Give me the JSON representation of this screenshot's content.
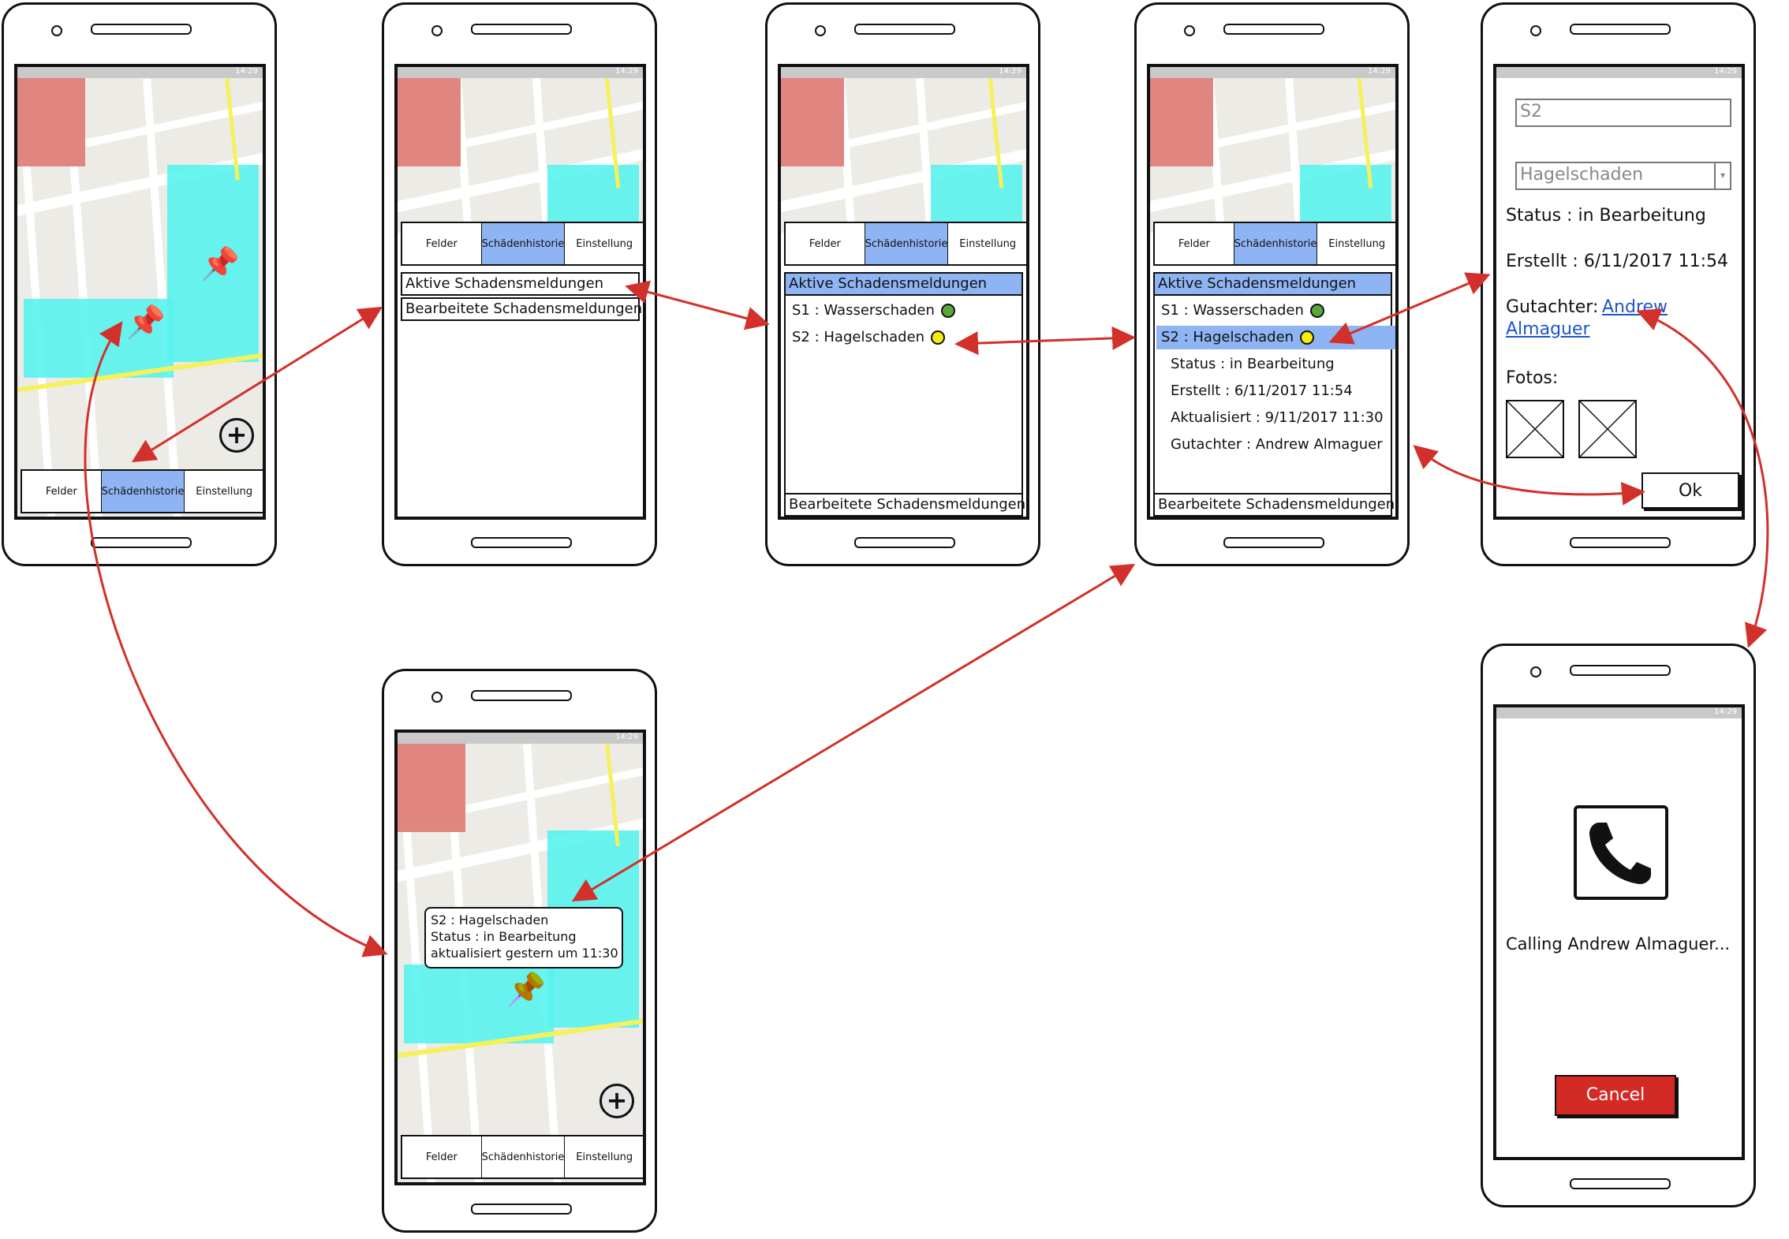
{
  "status_time": "14:29",
  "tabs": [
    "Felder",
    "Schädenhistorie",
    "Einstellung"
  ],
  "fab_symbol": "+",
  "lists": {
    "active": "Aktive Schadensmeldungen",
    "processed": "Bearbeitete Schadensmeldungen"
  },
  "reports": [
    {
      "label": "S1 : Wasserschaden",
      "status_color": "#5aa83c"
    },
    {
      "label": "S2 : Hagelschaden",
      "status_color": "#f6ec0f"
    }
  ],
  "details": {
    "status": "Status : in Bearbeitung",
    "created": "Erstellt : 6/11/2017 11:54",
    "updated": "Aktualisiert : 9/11/2017 11:30",
    "expert": "Gutachter : Andrew Almaguer"
  },
  "form": {
    "name_value": "S2",
    "type_value": "Hagelschaden",
    "status": "Status : in Bearbeitung",
    "created": "Erstellt : 6/11/2017 11:54",
    "expert_label": "Gutachter: ",
    "expert_link_line1": "Andrew",
    "expert_link_line2": "Almaguer",
    "photos_label": "Fotos:",
    "ok_label": "Ok"
  },
  "call": {
    "text": "Calling Andrew Almaguer...",
    "cancel_label": "Cancel"
  },
  "popup": {
    "line1": "S2 : Hagelschaden",
    "line2": "Status : in Bearbeitung",
    "line3": "aktualisiert gestern um 11:30"
  },
  "colors": {
    "arrow": "#d2302a",
    "active_tab": "#8fb4f3",
    "cyan_zone": "#59f3ee",
    "red_zone": "#e08580",
    "cancel": "#d32a24"
  }
}
